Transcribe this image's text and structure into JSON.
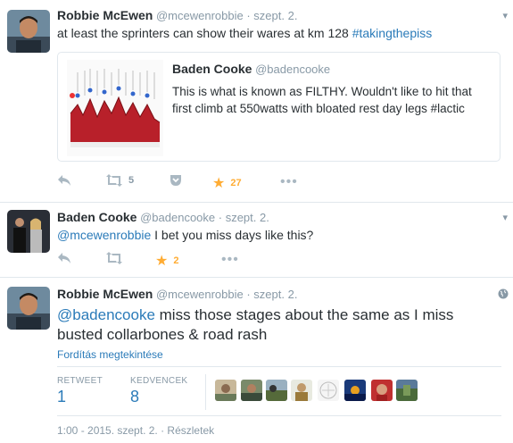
{
  "tweet1": {
    "name": "Robbie McEwen",
    "handle": "@mcewenrobbie",
    "time": "· szept. 2.",
    "text_plain": "at least the sprinters can show their wares at km 128 ",
    "hashtag": "#takingthepiss",
    "quote": {
      "name": "Baden Cooke",
      "handle": "@badencooke",
      "text": "This is what is known as FILTHY. Wouldn't like to hit that first climb at 550watts with bloated rest day legs #lactic"
    },
    "retweets": "5",
    "favorites": "27"
  },
  "tweet2": {
    "name": "Baden Cooke",
    "handle": "@badencooke",
    "time": "· szept. 2.",
    "mention": "@mcewenrobbie",
    "text_rest": " I bet you miss days like this?",
    "favorites": "2"
  },
  "tweet3": {
    "name": "Robbie McEwen",
    "handle": "@mcewenrobbie",
    "time": "· szept. 2.",
    "mention": "@badencooke",
    "text_rest": " miss those stages about the same as I miss busted collarbones & road rash",
    "translate": "Fordítás megtekintése",
    "retweet_label": "RETWEET",
    "retweet_count": "1",
    "favorites_label": "KEDVENCEK",
    "favorites_count": "8",
    "timestamp": "1:00 - 2015. szept. 2.",
    "details": "· Részletek"
  },
  "colors": {
    "link": "#2b7bb9",
    "star": "#ffac33",
    "muted": "#8899a6",
    "action": "#aab8c2",
    "divider": "#e1e8ed"
  }
}
